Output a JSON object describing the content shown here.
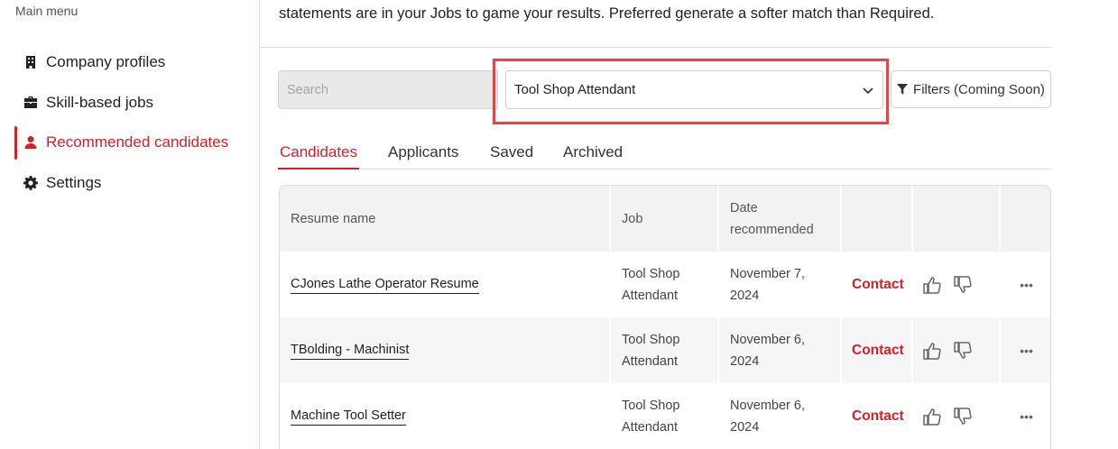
{
  "sidebar": {
    "title": "Main menu",
    "items": [
      {
        "label": "Company profiles",
        "icon": "building-icon",
        "active": false
      },
      {
        "label": "Skill-based jobs",
        "icon": "briefcase-icon",
        "active": false
      },
      {
        "label": "Recommended candidates",
        "icon": "user-icon",
        "active": true
      },
      {
        "label": "Settings",
        "icon": "gear-icon",
        "active": false
      }
    ]
  },
  "main": {
    "intro": "statements are in your Jobs to game your results. Preferred generate a softer match than Required.",
    "search": {
      "placeholder": "Search",
      "value": ""
    },
    "job_select": {
      "selected": "Tool Shop Attendant"
    },
    "filters_label": "Filters (Coming Soon)",
    "tabs": [
      {
        "label": "Candidates",
        "active": true
      },
      {
        "label": "Applicants",
        "active": false
      },
      {
        "label": "Saved",
        "active": false
      },
      {
        "label": "Archived",
        "active": false
      }
    ],
    "table": {
      "headers": {
        "resume": "Resume name",
        "job": "Job",
        "date_line1": "Date",
        "date_line2": "recommended"
      },
      "rows": [
        {
          "resume": "CJones Lathe Operator Resume",
          "job_line1": "Tool Shop",
          "job_line2": "Attendant",
          "date_line1": "November 7,",
          "date_line2": "2024",
          "contact": "Contact",
          "more": "•••"
        },
        {
          "resume": "TBolding - Machinist",
          "job_line1": "Tool Shop",
          "job_line2": "Attendant",
          "date_line1": "November 6,",
          "date_line2": "2024",
          "contact": "Contact",
          "more": "•••"
        },
        {
          "resume": "Machine Tool Setter",
          "job_line1": "Tool Shop",
          "job_line2": "Attendant",
          "date_line1": "November 6,",
          "date_line2": "2024",
          "contact": "Contact",
          "more": "•••"
        }
      ]
    }
  },
  "colors": {
    "accent": "#d61f26",
    "highlight": "#e0474c",
    "header_bg": "#f2f2f2"
  }
}
